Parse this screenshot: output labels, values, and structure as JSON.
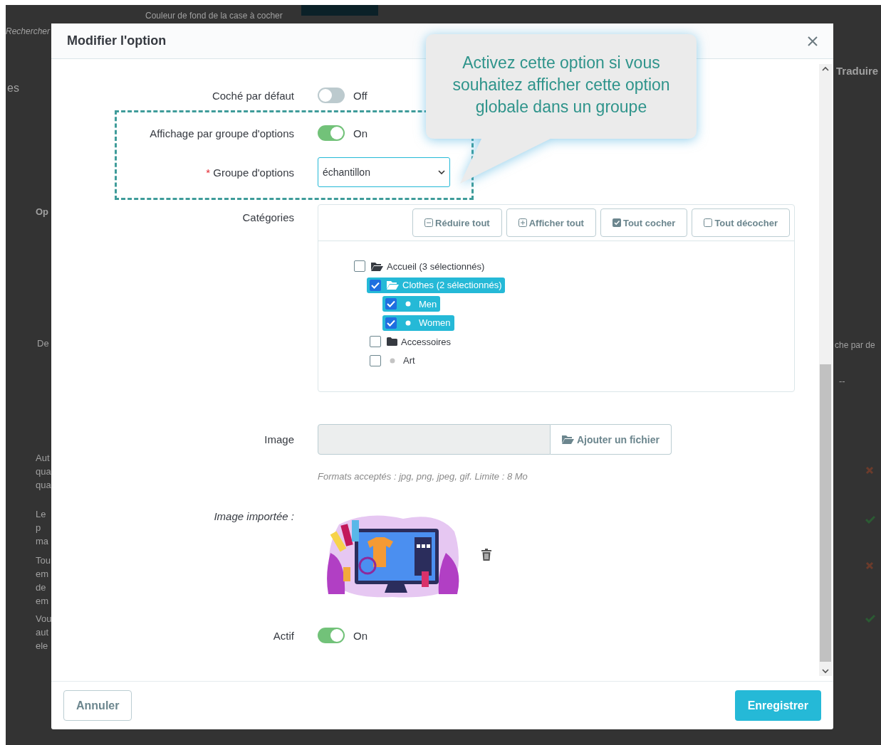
{
  "backdrop": {
    "top_text": "Couleur de fond de la case à cocher",
    "left_texts": [
      "Rechercher",
      "es",
      "Op",
      "De",
      "Aut\nqua\nqua",
      "Le p\nma",
      "Tou\nem\nde\nem",
      "Vou\naut\nele"
    ],
    "right_texts": [
      "Traduire",
      "che par de",
      "--"
    ],
    "right_marks": [
      {
        "kind": "cross"
      },
      {
        "kind": "check"
      },
      {
        "kind": "cross"
      },
      {
        "kind": "check"
      }
    ]
  },
  "modal": {
    "title": "Modifier l'option",
    "fields": [
      {
        "kind": "toggle",
        "label": "Coché par défaut",
        "on": false,
        "state_text": "Off"
      },
      {
        "kind": "toggle",
        "label": "Affichage par groupe d'options",
        "on": true,
        "state_text": "On"
      },
      {
        "kind": "select",
        "label": "Groupe d'options",
        "required": true,
        "required_mark": "*",
        "value": "échantillon"
      },
      {
        "kind": "tree",
        "label": "Catégories",
        "buttons": [
          {
            "kind": "collapse",
            "label": "Réduire tout"
          },
          {
            "kind": "expand",
            "label": "Afficher tout"
          },
          {
            "kind": "checkall",
            "label": "Tout cocher"
          },
          {
            "kind": "uncheckall",
            "label": "Tout décocher"
          }
        ],
        "nodes": [
          {
            "label": "Accueil (3 sélectionnés)",
            "kind": "branch",
            "expanded": true,
            "checked": false,
            "children": [
              {
                "label": "Clothes (2 sélectionnés)",
                "kind": "branch",
                "expanded": true,
                "checked": true,
                "children": [
                  {
                    "label": "Men",
                    "kind": "leaf",
                    "checked": true
                  },
                  {
                    "label": "Women",
                    "kind": "leaf",
                    "checked": true
                  }
                ]
              },
              {
                "label": "Accessoires",
                "kind": "branch",
                "expanded": false,
                "checked": false
              },
              {
                "label": "Art",
                "kind": "leaf",
                "checked": false
              }
            ]
          }
        ]
      },
      {
        "kind": "file",
        "label": "Image",
        "button": "Ajouter un fichier",
        "hint": "Formats acceptés : jpg, png, jpeg, gif. Limite : 8 Mo"
      },
      {
        "kind": "image",
        "label": "Image importée :"
      },
      {
        "kind": "toggle",
        "label": "Actif",
        "on": true,
        "state_text": "On"
      }
    ],
    "callout": "Activez cette option si vous souhaitez afficher cette option globale dans un groupe",
    "footer": {
      "cancel": "Annuler",
      "save": "Enregistrer"
    }
  }
}
